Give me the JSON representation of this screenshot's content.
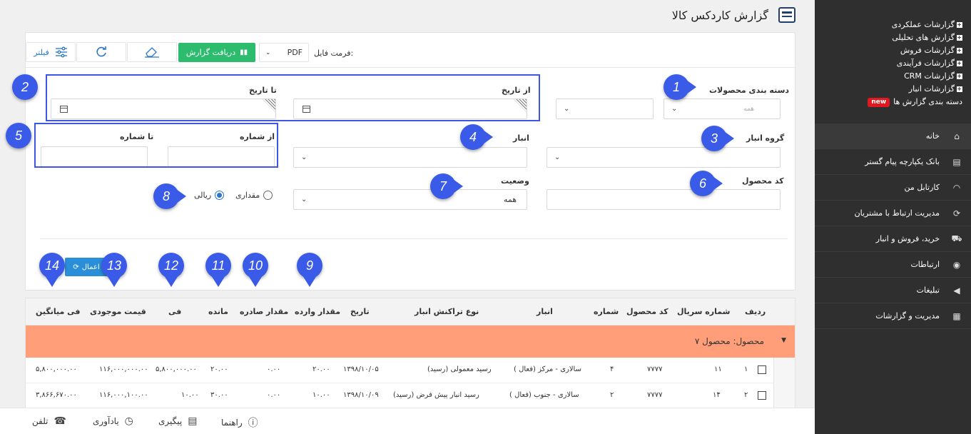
{
  "page": {
    "title": "گزارش کاردکس کالا"
  },
  "sidebar": {
    "reports": [
      {
        "label": "گزارشات عملکردی"
      },
      {
        "label": "گزارش های تحلیلی"
      },
      {
        "label": "گزارشات فروش"
      },
      {
        "label": "گزارشات فرآیندی"
      },
      {
        "label": "گزارشات CRM"
      },
      {
        "label": "گزارشات انبار"
      }
    ],
    "report_categories": {
      "label": "دسته بندی گزارش ها",
      "badge": "new"
    },
    "nav": [
      {
        "label": "خانه",
        "icon": "home-icon",
        "glyph": "⌂"
      },
      {
        "label": "بانک یکپارچه پیام گستر",
        "icon": "database-icon",
        "glyph": "▤"
      },
      {
        "label": "کارتابل من",
        "icon": "dashboard-icon",
        "glyph": "◠"
      },
      {
        "label": "مدیریت ارتباط با مشتریان",
        "icon": "cycle-icon",
        "glyph": "⟳"
      },
      {
        "label": "خرید، فروش و انبار",
        "icon": "truck-icon",
        "glyph": "⛟"
      },
      {
        "label": "ارتباطات",
        "icon": "broadcast-icon",
        "glyph": "◉"
      },
      {
        "label": "تبلیغات",
        "icon": "megaphone-icon",
        "glyph": "◀"
      },
      {
        "label": "مدیریت و گزارشات",
        "icon": "report-icon",
        "glyph": "▦"
      }
    ]
  },
  "toolbar": {
    "filter_label": "فیلتر",
    "get_report_label": "دریافت گزارش",
    "format_label": "فرمت فایل:",
    "format_value": "PDF"
  },
  "form": {
    "category": {
      "label": "دسته بندی محصولات",
      "placeholder": "همه"
    },
    "from_date": {
      "label": "از تاریخ"
    },
    "to_date": {
      "label": "تا تاریخ"
    },
    "warehouse_group": {
      "label": "گروه انبار"
    },
    "warehouse": {
      "label": "انبار"
    },
    "from_number": {
      "label": "از شماره"
    },
    "to_number": {
      "label": "تا شماره"
    },
    "product_code": {
      "label": "کد محصول"
    },
    "status": {
      "label": "وضعیت",
      "value": "همه"
    },
    "radio_quantity": "مقداری",
    "radio_rial": "ریالی",
    "apply_label": "اعمال"
  },
  "callouts": [
    "1",
    "2",
    "3",
    "4",
    "5",
    "6",
    "7",
    "8",
    "9",
    "10",
    "11",
    "12",
    "13",
    "14"
  ],
  "table": {
    "headers": {
      "row": "ردیف",
      "serial": "شماره سریال",
      "product_code": "کد محصول",
      "number": "شماره",
      "warehouse": "انبار",
      "transaction_type": "نوع تراکنش انبار",
      "date": "تاریخ",
      "qty_in": "مقدار وارده",
      "qty_out": "مقدار صادره",
      "remaining": "مانده",
      "unit_price": "فی",
      "stock_value": "قیمت موجودی",
      "avg_price": "فی میانگین"
    },
    "group_label": "محصول: محصول ۷",
    "rows": [
      {
        "row": "۱",
        "serial": "۱۱",
        "product_code": "۷۷۷۷",
        "number": "۴",
        "warehouse": "سالاری - مرکز (فعال )",
        "transaction_type": "رسید معمولی (رسید)",
        "date": "۱۳۹۸/۱۰/۰۵",
        "qty_in": "۲۰.۰۰",
        "qty_out": "۰.۰۰",
        "remaining": "۲۰.۰۰",
        "unit_price": "۵,۸۰۰,۰۰۰.۰۰",
        "stock_value": "۱۱۶,۰۰۰,۰۰۰.۰۰",
        "avg_price": "۵,۸۰۰,۰۰۰.۰۰"
      },
      {
        "row": "۲",
        "serial": "۱۴",
        "product_code": "۷۷۷۷",
        "number": "۲",
        "warehouse": "سالاری - جنوب (فعال )",
        "transaction_type": "رسید انبار پیش فرض (رسید)",
        "date": "۱۳۹۸/۱۰/۰۹",
        "qty_in": "۱۰.۰۰",
        "qty_out": "۰.۰۰",
        "remaining": "۳۰.۰۰",
        "unit_price": "۱۰.۰۰",
        "stock_value": "۱۱۶,۰۰۰,۱۰۰.۰۰",
        "avg_price": "۳,۸۶۶,۶۷۰.۰۰"
      }
    ]
  },
  "bottombar": {
    "help": "راهنما",
    "followup": "پیگیری",
    "reminder": "یادآوری",
    "phone": "تلفن"
  },
  "colors": {
    "sidebar": "#2f2f2f",
    "primary": "#2a77c9",
    "success": "#2dbb6e",
    "group_row": "#ff9e78",
    "callout": "#3a5ae8"
  }
}
